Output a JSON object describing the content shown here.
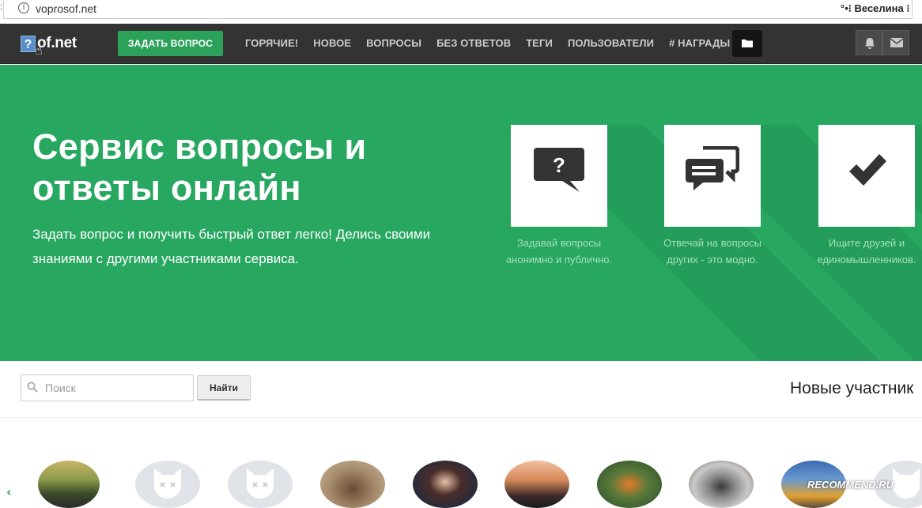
{
  "browser": {
    "left_fragment": ":",
    "url": "voprosof.net",
    "user_label": "°•⁝ Веселина ⁝"
  },
  "navbar": {
    "logo_mark": "?",
    "logo_text": "of.net",
    "ask_button": "ЗАДАТЬ ВОПРОС",
    "menu": [
      "ГОРЯЧИЕ!",
      "НОВОЕ",
      "ВОПРОСЫ",
      "БЕЗ ОТВЕТОВ",
      "ТЕГИ",
      "ПОЛЬЗОВАТЕЛИ",
      "# НАГРАДЫ"
    ],
    "icons": [
      "folder-icon",
      "bell-icon",
      "envelope-icon"
    ]
  },
  "hero": {
    "title": "Сервис вопросы и ответы онлайн",
    "subtitle": "Задать вопрос и получить быстрый ответ легко! Делись своими знаниями с другими участниками сервиса.",
    "background_color": "#27a760",
    "features": [
      {
        "icon": "question-bubble-icon",
        "caption": "Задавай вопросы анонимно и публично."
      },
      {
        "icon": "chat-bubbles-icon",
        "caption": "Отвечай на вопросы других - это модно."
      },
      {
        "icon": "checkmark-icon",
        "caption": "Ищите друзей и единомышленников."
      }
    ]
  },
  "search": {
    "placeholder": "Поиск",
    "button": "Найти"
  },
  "members": {
    "title": "Новые участник",
    "avatars": [
      "photo",
      "default",
      "default",
      "photo",
      "photo",
      "photo",
      "photo",
      "photo",
      "photo",
      "default"
    ]
  },
  "watermark": "RECOMMEND.RU",
  "colors": {
    "accent_green": "#2ba15a",
    "navbar": "#333333"
  }
}
